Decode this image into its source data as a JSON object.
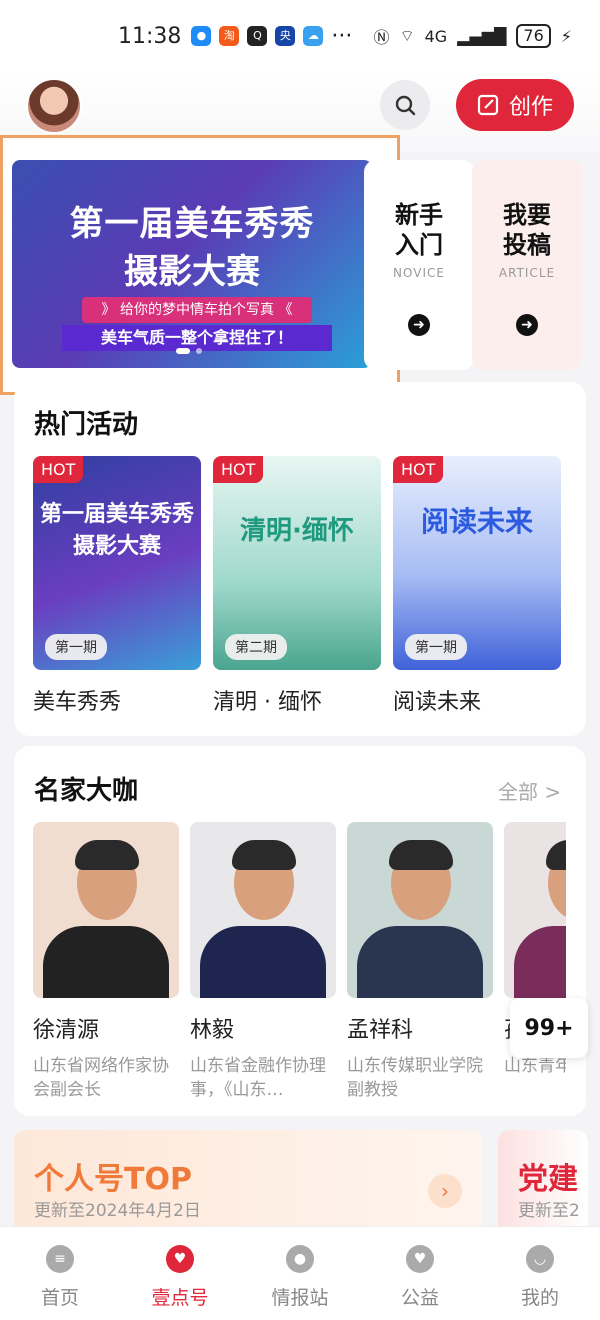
{
  "status_bar": {
    "time": "11:38",
    "network": "4G",
    "battery": "76",
    "more": "···"
  },
  "header": {
    "create_label": "创作"
  },
  "banner": {
    "title_line1": "第一届美车秀秀",
    "title_line2": "摄影大赛",
    "tagline1": "》 给你的梦中情车拍个写真 《",
    "tagline2": "美车气质一整个拿捏住了！"
  },
  "entries": [
    {
      "title": "新手\n入门",
      "sub": "NOVICE"
    },
    {
      "title": "我要\n投稿",
      "sub": "ARTICLE"
    }
  ],
  "hot_activities": {
    "title": "热门活动",
    "badge": "HOT",
    "items": [
      {
        "name": "美车秀秀",
        "episode": "第一期",
        "img_text": "第一届美车秀秀 摄影大赛"
      },
      {
        "name": "清明 · 缅怀",
        "episode": "第二期",
        "img_text": "清明·缅怀"
      },
      {
        "name": "阅读未来",
        "episode": "第一期",
        "img_text": "阅读未来"
      }
    ]
  },
  "experts": {
    "title": "名家大咖",
    "all_label": "全部 >",
    "items": [
      {
        "name": "徐清源",
        "desc": "山东省网络作家协会副会长"
      },
      {
        "name": "林毅",
        "desc": "山东省金融作协理事，《山东…"
      },
      {
        "name": "孟祥科",
        "desc": "山东传媒职业学院副教授"
      },
      {
        "name": "孙",
        "desc": "山东青年政治学院文化传"
      }
    ],
    "badge": "99+"
  },
  "top_cards": [
    {
      "title": "个人号TOP",
      "sub": "更新至2024年4月2日"
    },
    {
      "title": "党建",
      "sub": "更新至2"
    }
  ],
  "nav": [
    {
      "label": "首页"
    },
    {
      "label": "壹点号"
    },
    {
      "label": "情报站"
    },
    {
      "label": "公益"
    },
    {
      "label": "我的"
    }
  ]
}
